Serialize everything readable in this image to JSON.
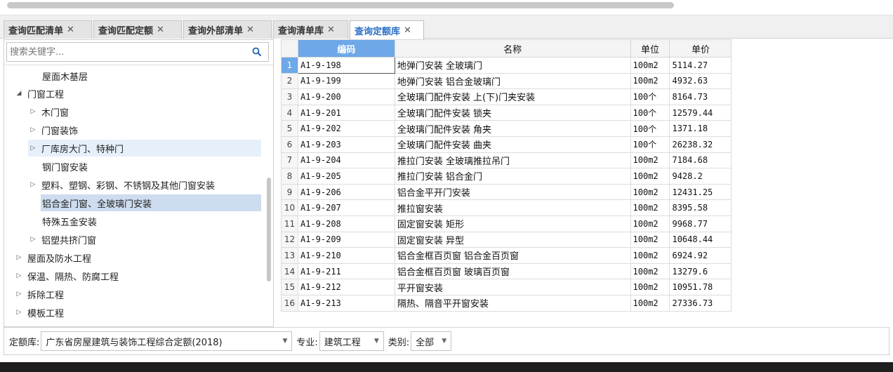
{
  "tabs": [
    {
      "label": "查询匹配清单",
      "close": "✕"
    },
    {
      "label": "查询匹配定额",
      "close": "✕"
    },
    {
      "label": "查询外部清单",
      "close": "✕"
    },
    {
      "label": "查询清单库",
      "close": "✕"
    },
    {
      "label": "查询定额库",
      "close": "✕"
    }
  ],
  "active_tab": "查询定额库",
  "search": {
    "placeholder": "搜索关键字..."
  },
  "tree": [
    {
      "label": "屋面木基层",
      "arrow": ""
    },
    {
      "label": "门窗工程",
      "arrow": "◢"
    },
    {
      "label": "木门窗",
      "arrow": "▷"
    },
    {
      "label": "门窗装饰",
      "arrow": "▷"
    },
    {
      "label": "厂库房大门、特种门",
      "arrow": "▷"
    },
    {
      "label": "钢门窗安装",
      "arrow": ""
    },
    {
      "label": "塑料、塑钢、彩钢、不锈钢及其他门窗安装",
      "arrow": "▷"
    },
    {
      "label": "铝合金门窗、全玻璃门安装",
      "arrow": ""
    },
    {
      "label": "特殊五金安装",
      "arrow": ""
    },
    {
      "label": "铝塑共挤门窗",
      "arrow": "▷"
    },
    {
      "label": "屋面及防水工程",
      "arrow": "▷"
    },
    {
      "label": "保温、隔热、防腐工程",
      "arrow": "▷"
    },
    {
      "label": "拆除工程",
      "arrow": "▷"
    },
    {
      "label": "模板工程",
      "arrow": "▷"
    }
  ],
  "grid": {
    "headers": {
      "code": "编码",
      "name": "名称",
      "unit": "单位",
      "price": "单价"
    },
    "rows": [
      {
        "idx": "1",
        "code": "A1-9-198",
        "name": "地弹门安装 全玻璃门",
        "unit": "100m2",
        "price": "5114.27"
      },
      {
        "idx": "2",
        "code": "A1-9-199",
        "name": "地弹门安装 铝合金玻璃门",
        "unit": "100m2",
        "price": "4932.63"
      },
      {
        "idx": "3",
        "code": "A1-9-200",
        "name": "全玻璃门配件安装 上(下)门夹安装",
        "unit": "100个",
        "price": "8164.73"
      },
      {
        "idx": "4",
        "code": "A1-9-201",
        "name": "全玻璃门配件安装 锁夹",
        "unit": "100个",
        "price": "12579.44"
      },
      {
        "idx": "5",
        "code": "A1-9-202",
        "name": "全玻璃门配件安装 角夹",
        "unit": "100个",
        "price": "1371.18"
      },
      {
        "idx": "6",
        "code": "A1-9-203",
        "name": "全玻璃门配件安装 曲夹",
        "unit": "100个",
        "price": "26238.32"
      },
      {
        "idx": "7",
        "code": "A1-9-204",
        "name": "推拉门安装 全玻璃推拉吊门",
        "unit": "100m2",
        "price": "7184.68"
      },
      {
        "idx": "8",
        "code": "A1-9-205",
        "name": "推拉门安装 铝合金门",
        "unit": "100m2",
        "price": "9428.2"
      },
      {
        "idx": "9",
        "code": "A1-9-206",
        "name": "铝合金平开门安装",
        "unit": "100m2",
        "price": "12431.25"
      },
      {
        "idx": "10",
        "code": "A1-9-207",
        "name": "推拉窗安装",
        "unit": "100m2",
        "price": "8395.58"
      },
      {
        "idx": "11",
        "code": "A1-9-208",
        "name": "固定窗安装 矩形",
        "unit": "100m2",
        "price": "9968.77"
      },
      {
        "idx": "12",
        "code": "A1-9-209",
        "name": "固定窗安装 异型",
        "unit": "100m2",
        "price": "10648.44"
      },
      {
        "idx": "13",
        "code": "A1-9-210",
        "name": "铝合金框百页窗 铝合金百页窗",
        "unit": "100m2",
        "price": "6924.92"
      },
      {
        "idx": "14",
        "code": "A1-9-211",
        "name": "铝合金框百页窗 玻璃百页窗",
        "unit": "100m2",
        "price": "13279.6"
      },
      {
        "idx": "15",
        "code": "A1-9-212",
        "name": "平开窗安装",
        "unit": "100m2",
        "price": "10951.78"
      },
      {
        "idx": "16",
        "code": "A1-9-213",
        "name": "隔热、隔音平开窗安装",
        "unit": "100m2",
        "price": "27336.73"
      }
    ]
  },
  "filters": {
    "library_label": "定额库:",
    "library_value": "广东省房屋建筑与装饰工程综合定额(2018)",
    "major_label": "专业:",
    "major_value": "建筑工程",
    "category_label": "类别:",
    "category_value": "全部"
  },
  "icons": {
    "search": "search-icon",
    "dropdown": "chevron-down-icon",
    "close": "close-icon"
  },
  "colors": {
    "accent": "#2a6fc6",
    "header_highlight": "#6ea8e8",
    "tree_selected": "#cddcee"
  }
}
